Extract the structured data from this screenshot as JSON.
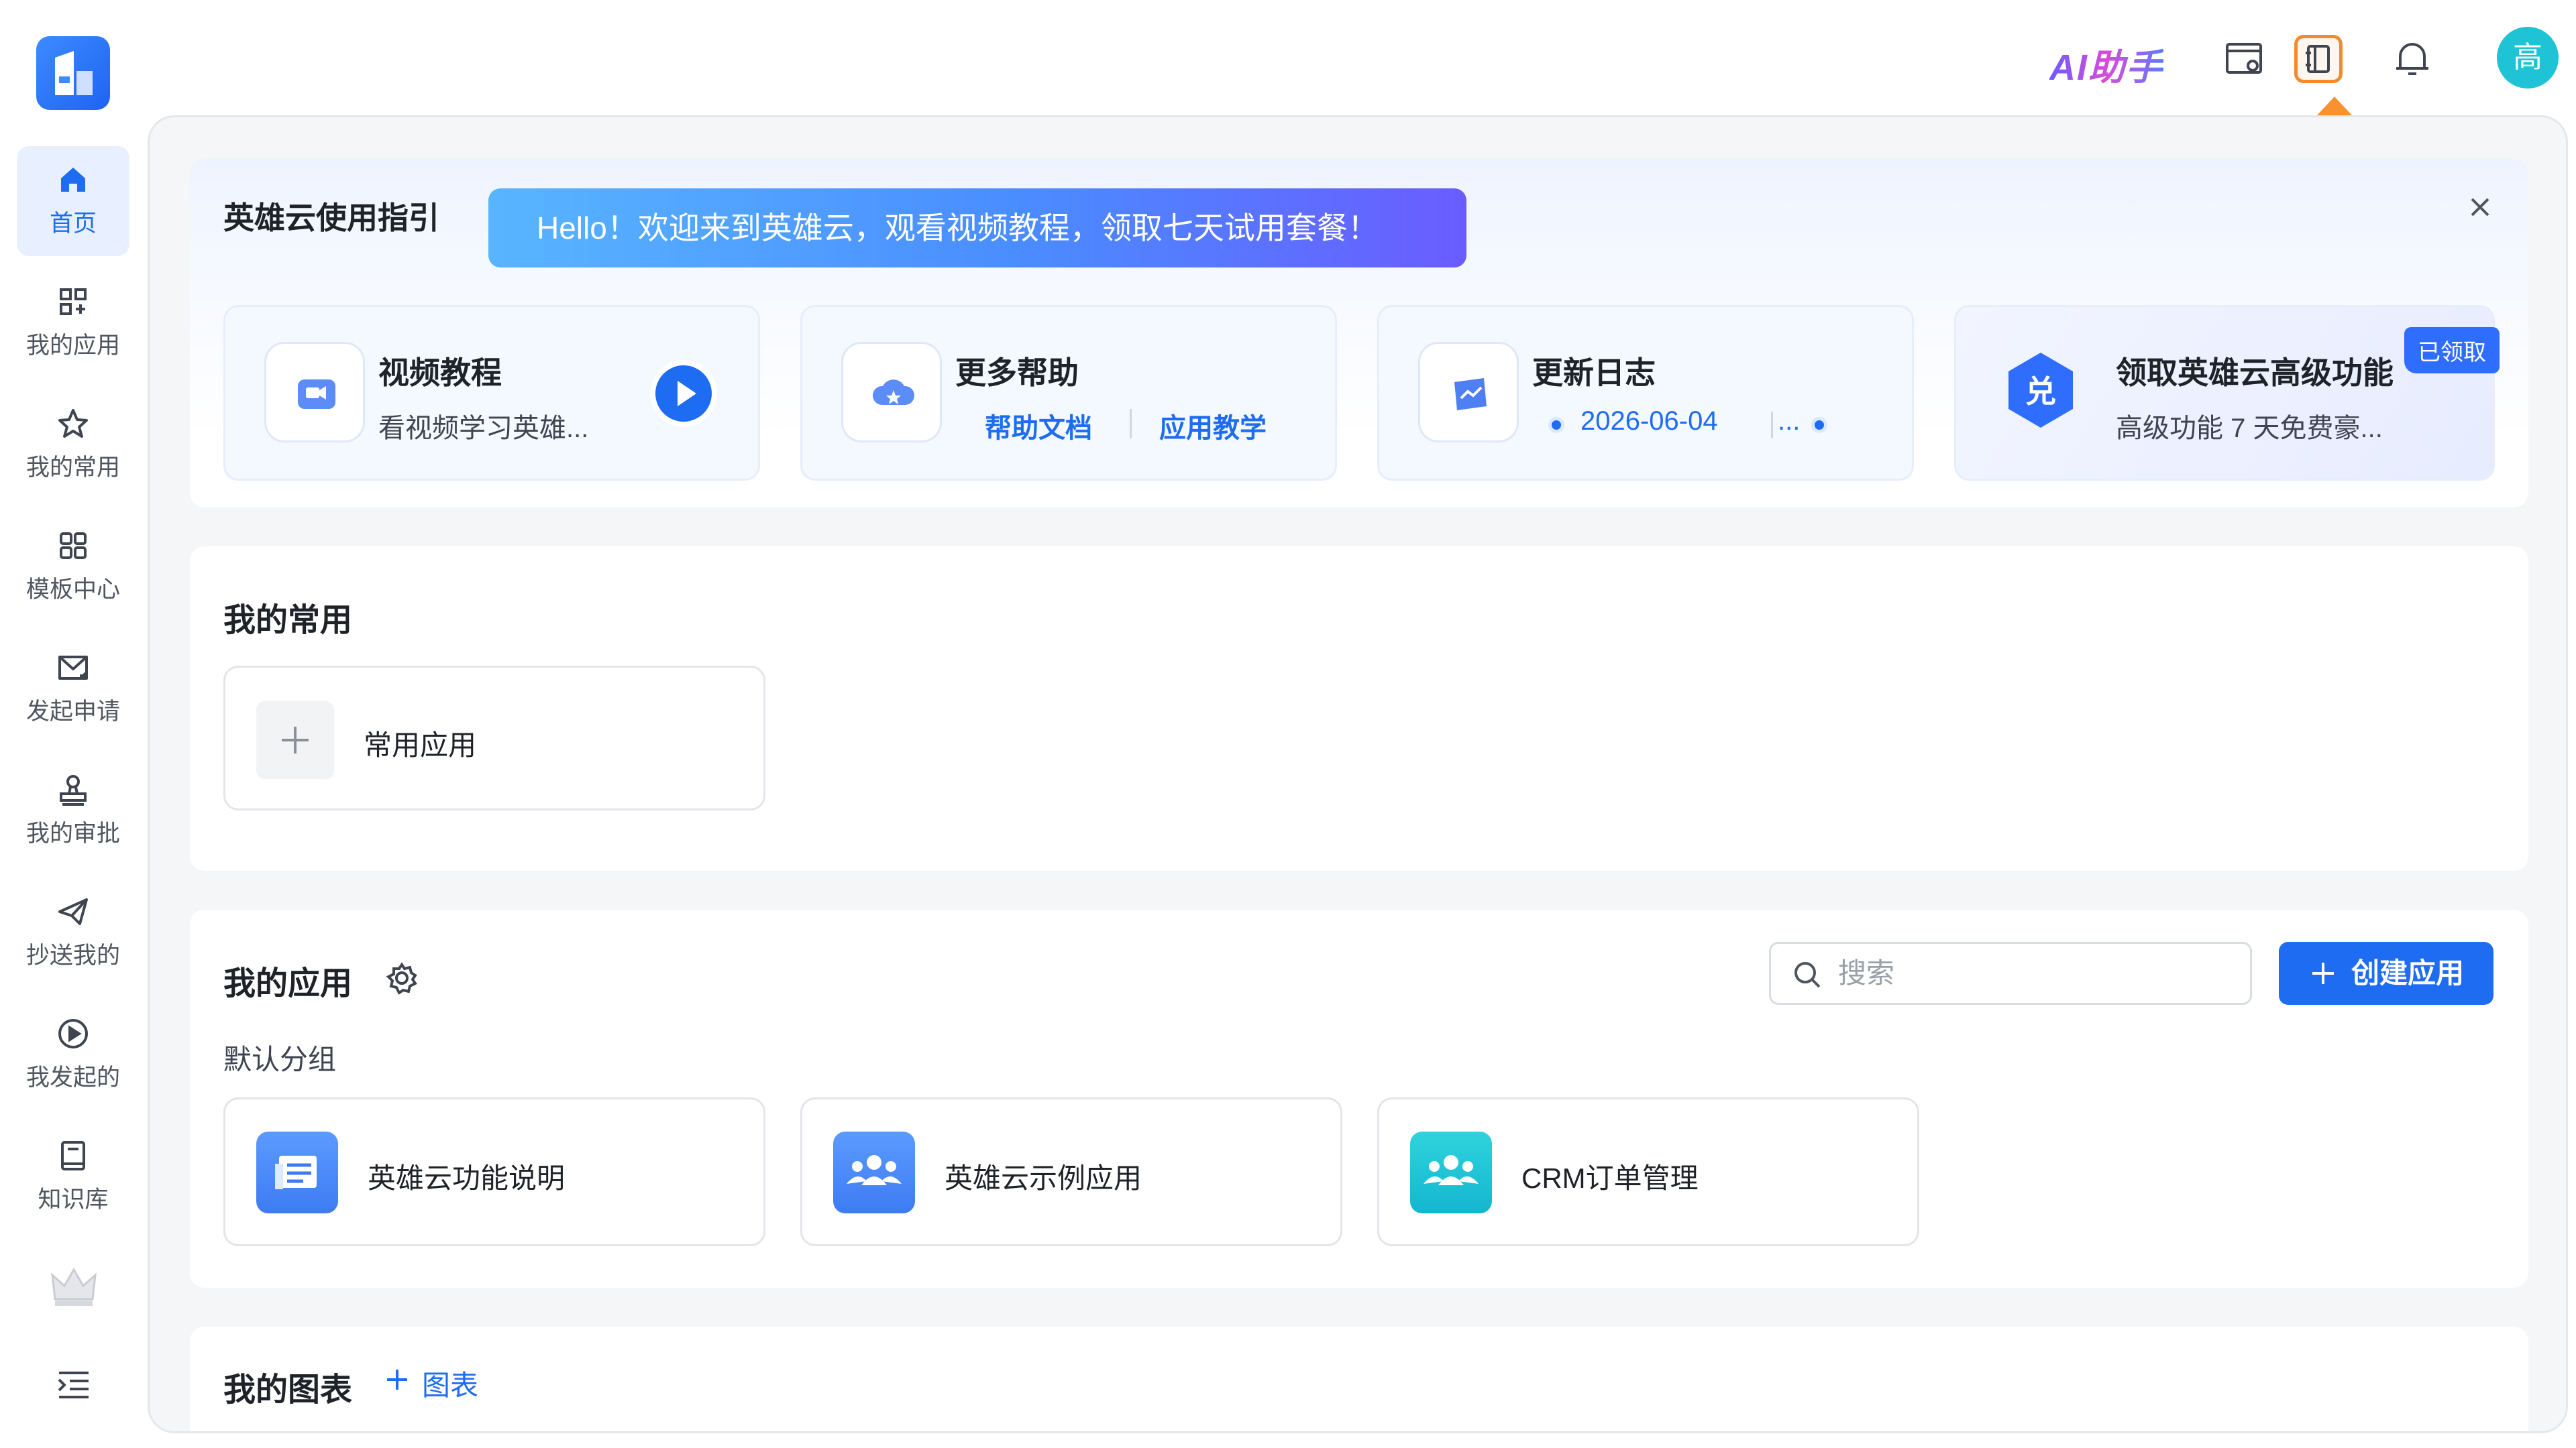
{
  "header": {
    "ai_assistant_label": "AI助手",
    "avatar_text": "高"
  },
  "sidebar": {
    "items": [
      {
        "label": "首页",
        "icon": "home-icon",
        "active": true
      },
      {
        "label": "我的应用",
        "icon": "apps-icon"
      },
      {
        "label": "我的常用",
        "icon": "star-icon"
      },
      {
        "label": "模板中心",
        "icon": "template-icon"
      },
      {
        "label": "发起申请",
        "icon": "mail-icon"
      },
      {
        "label": "我的审批",
        "icon": "approval-icon"
      },
      {
        "label": "抄送我的",
        "icon": "send-icon"
      },
      {
        "label": "我发起的",
        "icon": "play-circle-icon"
      },
      {
        "label": "知识库",
        "icon": "book-icon"
      }
    ]
  },
  "guide": {
    "title": "英雄云使用指引",
    "banner_text": "Hello！欢迎来到英雄云，观看视频教程，领取七天试用套餐！",
    "tiles": [
      {
        "title": "视频教程",
        "subtitle": "看视频学习英雄...",
        "icon": "video-icon"
      },
      {
        "title": "更多帮助",
        "links": [
          "帮助文档",
          "应用教学"
        ],
        "icon": "help-cloud-icon"
      },
      {
        "title": "更新日志",
        "date": "2026-06-04",
        "more": "...",
        "icon": "changelog-icon"
      },
      {
        "title": "领取英雄云高级功能",
        "subtitle": "高级功能 7 天免费豪...",
        "badge": "已领取",
        "icon": "redeem-icon"
      }
    ]
  },
  "common": {
    "title": "我的常用",
    "add_label": "常用应用"
  },
  "apps": {
    "title": "我的应用",
    "search_placeholder": "搜索",
    "create_label": "创建应用",
    "group_label": "默认分组",
    "items": [
      {
        "name": "英雄云功能说明",
        "color": "#3d86f7"
      },
      {
        "name": "英雄云示例应用",
        "color": "#3d86f7"
      },
      {
        "name": "CRM订单管理",
        "color": "#1ec3d6"
      }
    ]
  },
  "charts": {
    "title": "我的图表",
    "add_label": "图表"
  },
  "colors": {
    "primary": "#1d6cf2",
    "highlight_border": "#f28a2e",
    "arrow": "#f7922f"
  }
}
